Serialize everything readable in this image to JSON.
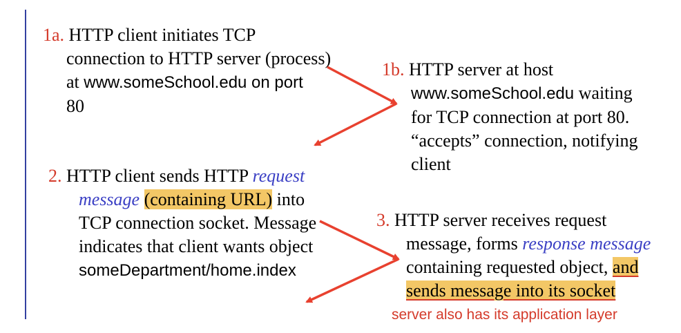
{
  "colors": {
    "step_number": "#d43a2a",
    "emphasis_blue": "#3a3fc4",
    "highlight": "#f3c766",
    "arrow": "#e8412f",
    "left_bar": "#3340a0"
  },
  "step_1a": {
    "num": "1a.",
    "t1": "HTTP client initiates TCP",
    "t2": "connection to HTTP server (process)",
    "t3": "at",
    "host": "www.someSchool.edu on port",
    "t4": "80"
  },
  "step_1b": {
    "num": "1b.",
    "t1": "HTTP server at host",
    "host": "www.someSchool.edu",
    "t2": "waiting",
    "t3": "for TCP connection at port 80.",
    "t4": "“accepts” connection, notifying",
    "t5": "client"
  },
  "step_2": {
    "num": "2.",
    "t1": "HTTP client sends HTTP",
    "em1": "request",
    "em2": "message",
    "hl": "(containing URL)",
    "t2": "into",
    "t3": "TCP connection socket. Message",
    "t4": "indicates that client wants object",
    "path": "someDepartment/home.index"
  },
  "step_3": {
    "num": "3.",
    "t1": "HTTP server receives request",
    "t2": "message, forms",
    "em": "response message",
    "t3": "containing requested object,",
    "hl1": "and",
    "hl2": "sends message into its socket"
  },
  "note": "server also has its application layer"
}
